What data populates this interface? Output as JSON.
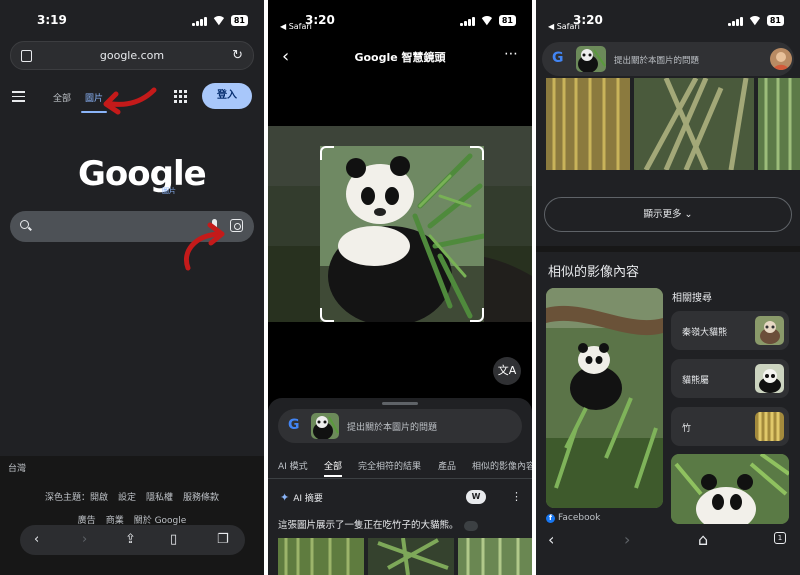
{
  "phone1": {
    "time": "3:19",
    "battery": "81",
    "url": "google.com",
    "tabs": [
      {
        "label": "全部"
      },
      {
        "label": "圖片"
      }
    ],
    "signin_label": "登入",
    "logo": "Google",
    "logo_sub": "圖片",
    "region": "台灣",
    "footer_row1": [
      "深色主題：開啟",
      "設定",
      "隱私權",
      "服務條款"
    ],
    "footer_row2": [
      "廣告",
      "商業",
      "關於 Google"
    ]
  },
  "phone2": {
    "time": "3:20",
    "back_app": "◀ Safari",
    "battery": "81",
    "title": "Google 智慧鏡頭",
    "ask_placeholder": "提出關於本圖片的問題",
    "tabs": [
      "AI 模式",
      "全部",
      "完全相符的結果",
      "產品",
      "相似的影像內容"
    ],
    "active_tab": "全部",
    "ai_overview_label": "AI 摘要",
    "ai_text": "這張圖片展示了一隻正在吃竹子的大貓熊。"
  },
  "phone3": {
    "time": "3:20",
    "back_app": "◀ Safari",
    "battery": "81",
    "ask_placeholder": "提出關於本圖片的問題",
    "show_more": "顯示更多",
    "similar_title": "相似的影像內容",
    "related_title": "相關搜尋",
    "related": [
      {
        "label": "秦嶺大貓熊"
      },
      {
        "label": "貓熊屬"
      },
      {
        "label": "竹"
      }
    ],
    "source": "Facebook",
    "tab_count": "1"
  },
  "colors": {
    "background": "#202124",
    "accent": "#8ab4f8",
    "signin_bg": "#a8c7fa",
    "arrow_red": "#c41a1a"
  }
}
